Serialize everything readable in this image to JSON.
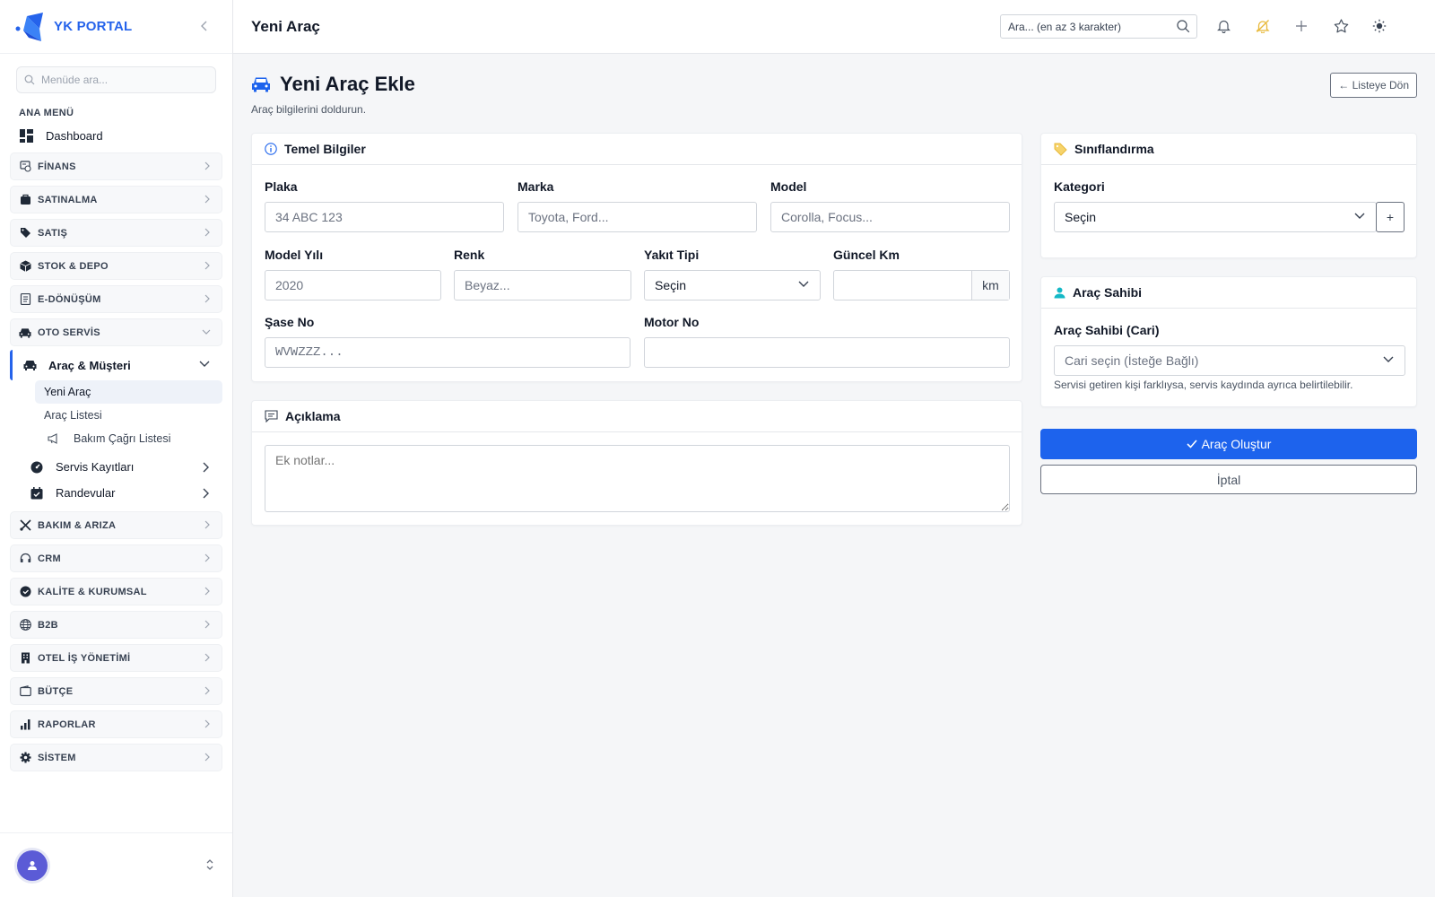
{
  "brand": {
    "name": "YK PORTAL"
  },
  "sidebar": {
    "search_placeholder": "Menüde ara...",
    "heading": "ANA MENÜ",
    "dashboard": "Dashboard",
    "groups_top": [
      {
        "label": "FİNANS",
        "icon": "finance-icon"
      },
      {
        "label": "SATINALMA",
        "icon": "purchase-icon"
      },
      {
        "label": "SATIŞ",
        "icon": "tag-icon"
      },
      {
        "label": "STOK & DEPO",
        "icon": "box-icon"
      },
      {
        "label": "E-DÖNÜŞÜM",
        "icon": "document-icon"
      },
      {
        "label": "OTO SERVİS",
        "icon": "car-icon"
      }
    ],
    "oto_servis": {
      "section": "Araç & Müşteri",
      "items": [
        "Yeni Araç",
        "Araç Listesi",
        "Bakım Çağrı Listesi"
      ],
      "servis": "Servis Kayıtları",
      "randevu": "Randevular"
    },
    "groups_bottom": [
      {
        "label": "BAKIM & ARIZA",
        "icon": "tools-icon"
      },
      {
        "label": "CRM",
        "icon": "headset-icon"
      },
      {
        "label": "KALİTE & KURUMSAL",
        "icon": "badge-icon"
      },
      {
        "label": "B2B",
        "icon": "globe-icon"
      },
      {
        "label": "OTEL İŞ YÖNETİMİ",
        "icon": "building-icon"
      },
      {
        "label": "BÜTÇE",
        "icon": "wallet-icon"
      },
      {
        "label": "RAPORLAR",
        "icon": "bar-chart-icon"
      },
      {
        "label": "SİSTEM",
        "icon": "gear-icon"
      }
    ]
  },
  "topbar": {
    "title": "Yeni Araç",
    "search_placeholder": "Ara... (en az 3 karakter)"
  },
  "page": {
    "title": "Yeni Araç Ekle",
    "subtitle": "Araç bilgilerini doldurun.",
    "back_label": "← Listeye Dön"
  },
  "temel": {
    "title": "Temel Bilgiler",
    "plaka": {
      "label": "Plaka",
      "placeholder": "34 ABC 123"
    },
    "marka": {
      "label": "Marka",
      "placeholder": "Toyota, Ford..."
    },
    "model": {
      "label": "Model",
      "placeholder": "Corolla, Focus..."
    },
    "yil": {
      "label": "Model Yılı",
      "placeholder": "2020"
    },
    "renk": {
      "label": "Renk",
      "placeholder": "Beyaz..."
    },
    "yakit": {
      "label": "Yakıt Tipi",
      "value": "Seçin"
    },
    "km": {
      "label": "Güncel Km",
      "suffix": "km"
    },
    "sase": {
      "label": "Şase No",
      "placeholder": "WVWZZZ..."
    },
    "motor": {
      "label": "Motor No"
    }
  },
  "aciklama": {
    "title": "Açıklama",
    "placeholder": "Ek notlar..."
  },
  "sinif": {
    "title": "Sınıflandırma",
    "kategori_label": "Kategori",
    "kategori_value": "Seçin",
    "add": "+"
  },
  "sahip": {
    "title": "Araç Sahibi",
    "label": "Araç Sahibi (Cari)",
    "value": "Cari seçin (İsteğe Bağlı)",
    "hint": "Servisi getiren kişi farklıysa, servis kaydında ayrıca belirtilebilir."
  },
  "actions": {
    "create": "Araç Oluştur",
    "cancel": "İptal"
  },
  "colors": {
    "primary": "#1d63ed",
    "brand": "#2563eb",
    "accent_icon": "#e8b93a",
    "teal": "#14b8c6"
  }
}
